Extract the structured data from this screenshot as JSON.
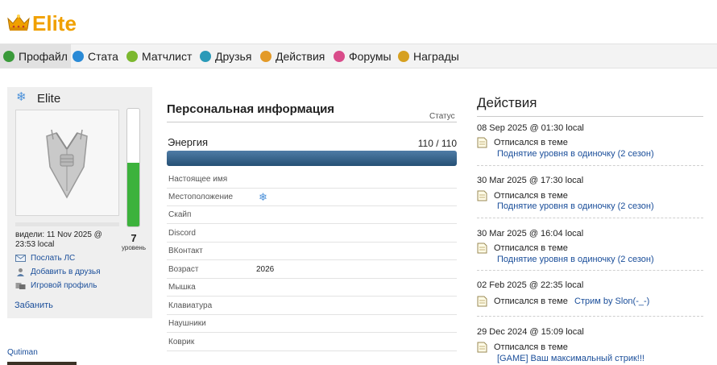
{
  "site": {
    "title": "Elite"
  },
  "nav": [
    {
      "label": "Профайл",
      "icon": "profile-icon",
      "color": "#3a9a3a",
      "active": true
    },
    {
      "label": "Стата",
      "icon": "stats-icon",
      "color": "#2a8ad6"
    },
    {
      "label": "Матчлист",
      "icon": "matchlist-icon",
      "color": "#7cb82f"
    },
    {
      "label": "Друзья",
      "icon": "friends-icon",
      "color": "#2a9ab8"
    },
    {
      "label": "Действия",
      "icon": "actions-icon",
      "color": "#e39a28"
    },
    {
      "label": "Форумы",
      "icon": "forums-icon",
      "color": "#d94c8a"
    },
    {
      "label": "Награды",
      "icon": "awards-icon",
      "color": "#d6a020"
    }
  ],
  "profile": {
    "username": "Elite",
    "level": "7",
    "level_caption": "уровень",
    "level_fill": 0.54,
    "seen": "видели: 11 Nov 2025 @ 23:53 local",
    "links": [
      {
        "label": "Послать ЛС",
        "icon": "mail-icon"
      },
      {
        "label": "Добавить в друзья",
        "icon": "add-friend-icon"
      },
      {
        "label": "Игровой профиль",
        "icon": "game-profile-icon"
      }
    ],
    "ban_label": "Забанить",
    "below_name": "Qutiman"
  },
  "personal": {
    "title": "Персональная информация",
    "status_label": "Статус",
    "energy_label": "Энергия",
    "energy_value": "110 / 110",
    "energy_fraction": 1.0,
    "rows": [
      {
        "label": "Настоящее имя",
        "value": ""
      },
      {
        "label": "Местоположение",
        "value": "",
        "icon": "snowflake-icon"
      },
      {
        "label": "Скайп",
        "value": ""
      },
      {
        "label": "Discord",
        "value": ""
      },
      {
        "label": "ВКонтакт",
        "value": ""
      },
      {
        "label": "Возраст",
        "value": "2026"
      },
      {
        "label": "Мышка",
        "value": ""
      },
      {
        "label": "Клавиатура",
        "value": ""
      },
      {
        "label": "Наушники",
        "value": ""
      },
      {
        "label": "Коврик",
        "value": ""
      }
    ]
  },
  "actions": {
    "title": "Действия",
    "items": [
      {
        "date": "08 Sep 2025 @ 01:30 local",
        "text": "Отписался в теме",
        "link": "Поднятие уровня в одиночку (2 сезон)"
      },
      {
        "date": "30 Mar 2025 @ 17:30 local",
        "text": "Отписался в теме",
        "link": "Поднятие уровня в одиночку (2 сезон)"
      },
      {
        "date": "30 Mar 2025 @ 16:04 local",
        "text": "Отписался в теме",
        "link": "Поднятие уровня в одиночку (2 сезон)"
      },
      {
        "date": "02 Feb 2025 @ 22:35 local",
        "text": "Отписался в теме",
        "link": "Стрим by Slon(-_-)"
      },
      {
        "date": "29 Dec 2024 @ 15:09 local",
        "text": "Отписался в теме",
        "link": "[GAME] Ваш максимальный стрик!!!"
      }
    ]
  },
  "colors": {
    "accent": "#f0a000",
    "link": "#1a4e9a",
    "level": "#3cb23c",
    "energy": "#255075"
  }
}
